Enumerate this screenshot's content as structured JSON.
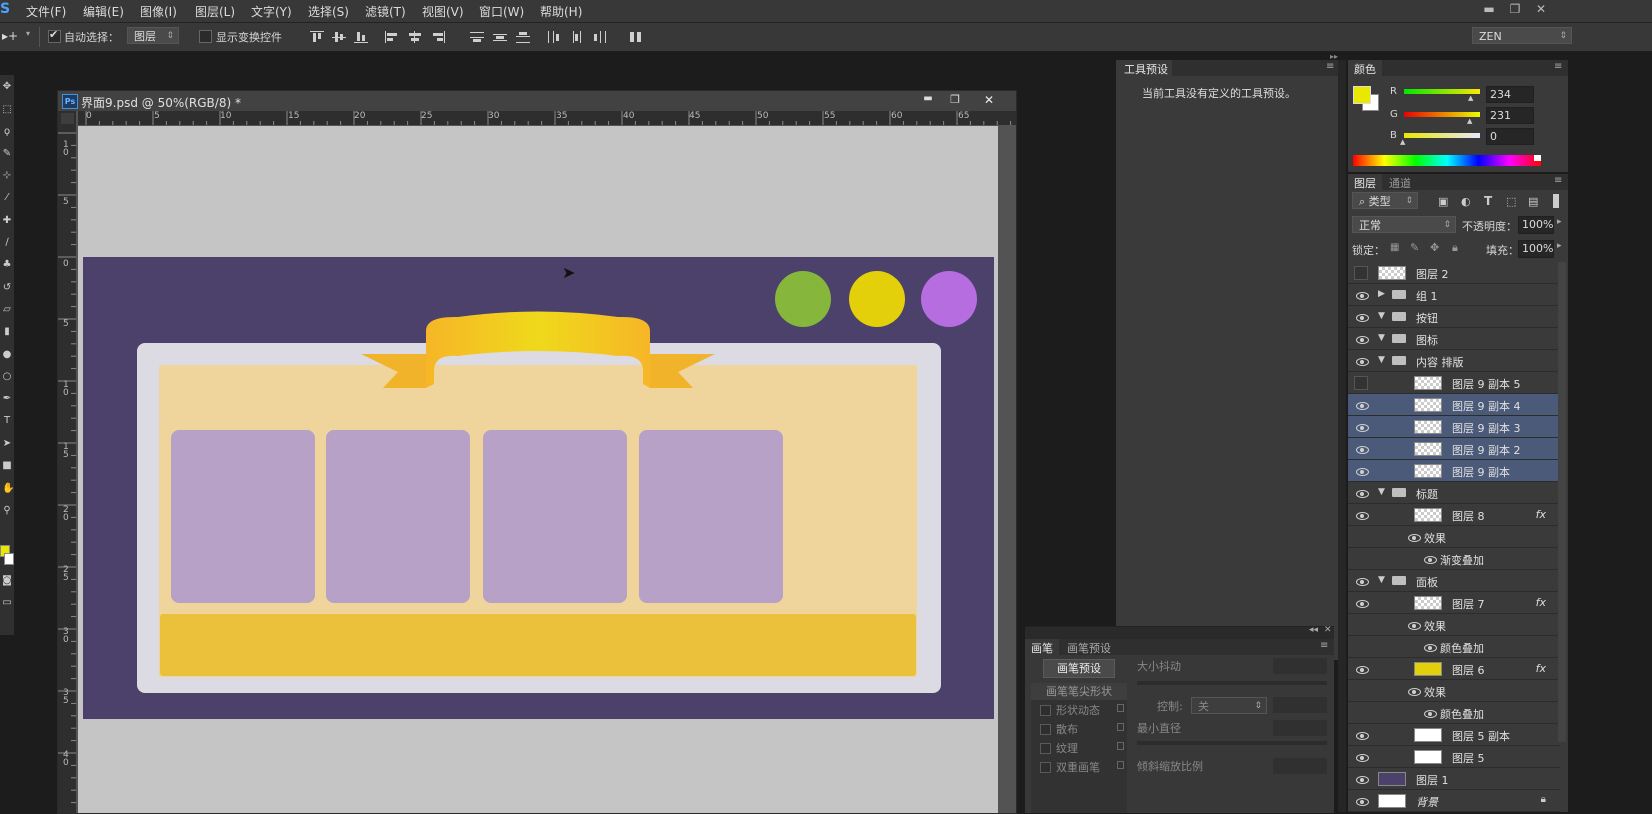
{
  "menubar": {
    "app_glyph": "S",
    "items": [
      "文件(F)",
      "编辑(E)",
      "图像(I)",
      "图层(L)",
      "文字(Y)",
      "选择(S)",
      "滤镜(T)",
      "视图(V)",
      "窗口(W)",
      "帮助(H)"
    ]
  },
  "options_bar": {
    "move_tool_glyph": "▸+",
    "auto_select_label": "自动选择：",
    "auto_select_checked": true,
    "auto_select_target": "图层",
    "show_transform_label": "显示变换控件",
    "show_transform_checked": false,
    "workspace": "ZEN"
  },
  "document": {
    "ps_badge": "Ps",
    "title": "界面9.psd @ 50%(RGB/8) *",
    "minimize": "▬",
    "restore": "❐",
    "close": "✕",
    "ruler_h": [
      "0",
      "5",
      "10",
      "15",
      "20",
      "25",
      "30",
      "35",
      "40",
      "45",
      "50",
      "55",
      "60",
      "65"
    ],
    "ruler_v": [
      "1\n0",
      "5",
      "0",
      "5",
      "1\n0",
      "1\n5",
      "2\n0",
      "2\n5",
      "3\n0",
      "3\n5",
      "4\n0"
    ],
    "artwork": {
      "background_color": "#4b416b",
      "panel_color": "#dcdbe3",
      "inner_color": "#efd49b",
      "card_color": "#b7a1c6",
      "bar_color": "#ebc13b",
      "ribbon_color": "#f2c61f",
      "circles": [
        "#86b63b",
        "#e3d00a",
        "#b66ddf"
      ]
    }
  },
  "tool_presets_panel": {
    "tab": "工具预设",
    "message": "当前工具没有定义的工具预设。"
  },
  "color_panel": {
    "tab": "颜色",
    "foreground": "#eae700",
    "channels": [
      {
        "label": "R",
        "value": "234"
      },
      {
        "label": "G",
        "value": "231"
      },
      {
        "label": "B",
        "value": "0"
      }
    ]
  },
  "layers_panel": {
    "tabs": [
      "图层",
      "通道"
    ],
    "filter_kind": "类型",
    "blend_mode": "正常",
    "opacity_label": "不透明度：",
    "opacity_value": "100%",
    "lock_label": "锁定：",
    "fill_label": "填充：",
    "fill_value": "100%",
    "fx_label": "fx",
    "layers": [
      {
        "name": "图层 2",
        "type": "layer",
        "indent": 0,
        "visible": false,
        "thumb": "checker",
        "selected": false
      },
      {
        "name": "组 1",
        "type": "group",
        "indent": 0,
        "visible": true,
        "expanded": false,
        "selected": false
      },
      {
        "name": "按钮",
        "type": "group",
        "indent": 0,
        "visible": true,
        "expanded": true,
        "selected": false
      },
      {
        "name": "图标",
        "type": "group",
        "indent": 0,
        "visible": true,
        "expanded": true,
        "selected": false
      },
      {
        "name": "内容 排版",
        "type": "group",
        "indent": 0,
        "visible": true,
        "expanded": true,
        "selected": false
      },
      {
        "name": "图层 9 副本 5",
        "type": "layer",
        "indent": 1,
        "visible": false,
        "thumb": "checker",
        "selected": false
      },
      {
        "name": "图层 9 副本 4",
        "type": "layer",
        "indent": 1,
        "visible": true,
        "thumb": "checker",
        "selected": true
      },
      {
        "name": "图层 9 副本 3",
        "type": "layer",
        "indent": 1,
        "visible": true,
        "thumb": "checker",
        "selected": true
      },
      {
        "name": "图层 9 副本 2",
        "type": "layer",
        "indent": 1,
        "visible": true,
        "thumb": "checker",
        "selected": true
      },
      {
        "name": "图层 9 副本",
        "type": "layer",
        "indent": 1,
        "visible": true,
        "thumb": "checker",
        "selected": true
      },
      {
        "name": "标题",
        "type": "group",
        "indent": 0,
        "visible": true,
        "expanded": true,
        "selected": false
      },
      {
        "name": "图层 8",
        "type": "layer",
        "indent": 1,
        "visible": true,
        "thumb": "checker",
        "fx": true,
        "selected": false
      },
      {
        "name": "效果",
        "type": "effect",
        "indent": 2,
        "selected": false
      },
      {
        "name": "渐变叠加",
        "type": "effect",
        "indent": 3,
        "selected": false
      },
      {
        "name": "面板",
        "type": "group",
        "indent": 0,
        "visible": true,
        "expanded": true,
        "selected": false
      },
      {
        "name": "图层 7",
        "type": "layer",
        "indent": 1,
        "visible": true,
        "thumb": "checker",
        "fx": true,
        "selected": false
      },
      {
        "name": "效果",
        "type": "effect",
        "indent": 2,
        "selected": false
      },
      {
        "name": "颜色叠加",
        "type": "effect",
        "indent": 3,
        "selected": false
      },
      {
        "name": "图层 6",
        "type": "layer",
        "indent": 1,
        "visible": true,
        "thumb": "yellow",
        "fx": true,
        "selected": false
      },
      {
        "name": "效果",
        "type": "effect",
        "indent": 2,
        "selected": false
      },
      {
        "name": "颜色叠加",
        "type": "effect",
        "indent": 3,
        "selected": false
      },
      {
        "name": "图层 5 副本",
        "type": "layer",
        "indent": 1,
        "visible": true,
        "thumb": "white",
        "selected": false
      },
      {
        "name": "图层 5",
        "type": "layer",
        "indent": 1,
        "visible": true,
        "thumb": "white",
        "selected": false
      },
      {
        "name": "图层 1",
        "type": "layer",
        "indent": 0,
        "visible": true,
        "thumb": "purple",
        "selected": false
      },
      {
        "name": "背景",
        "type": "layer",
        "indent": 0,
        "visible": true,
        "thumb": "white",
        "locked": true,
        "selected": false
      }
    ]
  },
  "brush_panel": {
    "tabs": [
      "画笔",
      "画笔预设"
    ],
    "preset_button": "画笔预设",
    "tip_shape": "画笔笔尖形状",
    "options": [
      "形状动态",
      "散布",
      "纹理",
      "双重画笔"
    ],
    "size_jitter": "大小抖动",
    "control_label": "控制:",
    "control_value": "关",
    "min_diameter": "最小直径",
    "tilt_scale": "倾斜缩放比例"
  }
}
